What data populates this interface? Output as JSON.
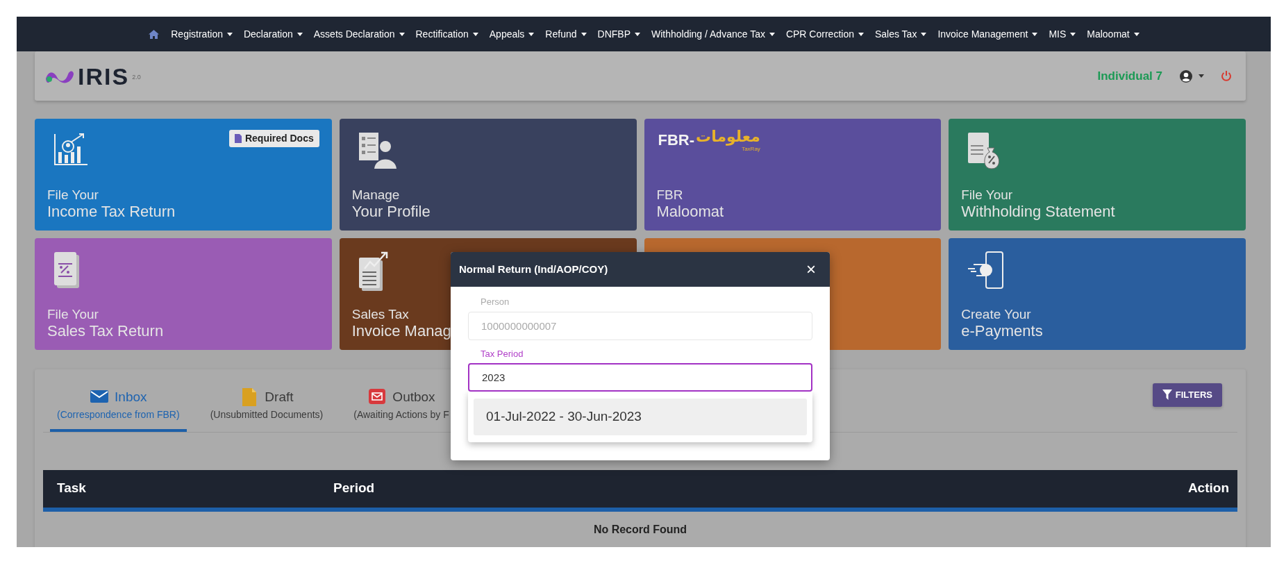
{
  "nav_menu": [
    {
      "label": "Registration"
    },
    {
      "label": "Declaration"
    },
    {
      "label": "Assets Declaration"
    },
    {
      "label": "Rectification"
    },
    {
      "label": "Appeals"
    },
    {
      "label": "Refund"
    },
    {
      "label": "DNFBP"
    },
    {
      "label": "Withholding / Advance Tax"
    },
    {
      "label": "CPR Correction"
    },
    {
      "label": "Sales Tax"
    },
    {
      "label": "Invoice Management"
    },
    {
      "label": "MIS"
    },
    {
      "label": "Maloomat"
    }
  ],
  "header": {
    "logo": {
      "text": "IRIS",
      "version": "2.0"
    },
    "user_name": "Individual 7"
  },
  "tiles": [
    {
      "kind": "chart",
      "color": "#1a76c0",
      "line1": "File Your",
      "line2": "Income Tax Return",
      "badge": "Required Docs"
    },
    {
      "kind": "profile",
      "color": "#39415e",
      "line1": "Manage",
      "line2": "Your Profile"
    },
    {
      "kind": "maloomat",
      "color": "#5a4e9c",
      "line1": "FBR",
      "line2": "Maloomat",
      "logo": {
        "latin": "FBR-",
        "urdu": "معلومات",
        "tagline": "TaxRay"
      }
    },
    {
      "kind": "wht",
      "color": "#2a7a5e",
      "line1": "File Your",
      "line2": "Withholding Statement"
    },
    {
      "kind": "tax",
      "color": "#9a5cb4",
      "line1": "File Your",
      "line2": "Sales Tax Return"
    },
    {
      "kind": "invoice",
      "color": "#6a3a1e",
      "line1": "Sales Tax",
      "line2": "Invoice Manag"
    },
    {
      "kind": "blank",
      "color": "#b8682e"
    },
    {
      "kind": "payment",
      "color": "#2a5e9e",
      "line1": "Create Your",
      "line2": "e-Payments"
    }
  ],
  "tabs": [
    {
      "kind": "inbox",
      "label": "Inbox",
      "note": "(Correspondence from FBR)",
      "selected": true
    },
    {
      "kind": "draft",
      "label": "Draft",
      "note": "(Unsubmitted Documents)",
      "selected": false
    },
    {
      "kind": "outbox",
      "label": "Outbox",
      "note": "(Awaiting Actions by F",
      "selected": false
    }
  ],
  "filters_button": "FILTERS",
  "table": {
    "columns": [
      "Task",
      "Period",
      "Action"
    ],
    "empty_message": "No Record Found"
  },
  "modal": {
    "title": "Normal Return (Ind/AOP/COY)",
    "close": "×",
    "fields": [
      {
        "label": "Person",
        "value": "1000000000007",
        "disabled": true,
        "focused": false
      },
      {
        "label": "Tax Period",
        "value": "2023",
        "disabled": false,
        "focused": true
      }
    ],
    "options": [
      {
        "label": "01-Jul-2022 - 30-Jun-2023",
        "selected": true
      }
    ]
  }
}
